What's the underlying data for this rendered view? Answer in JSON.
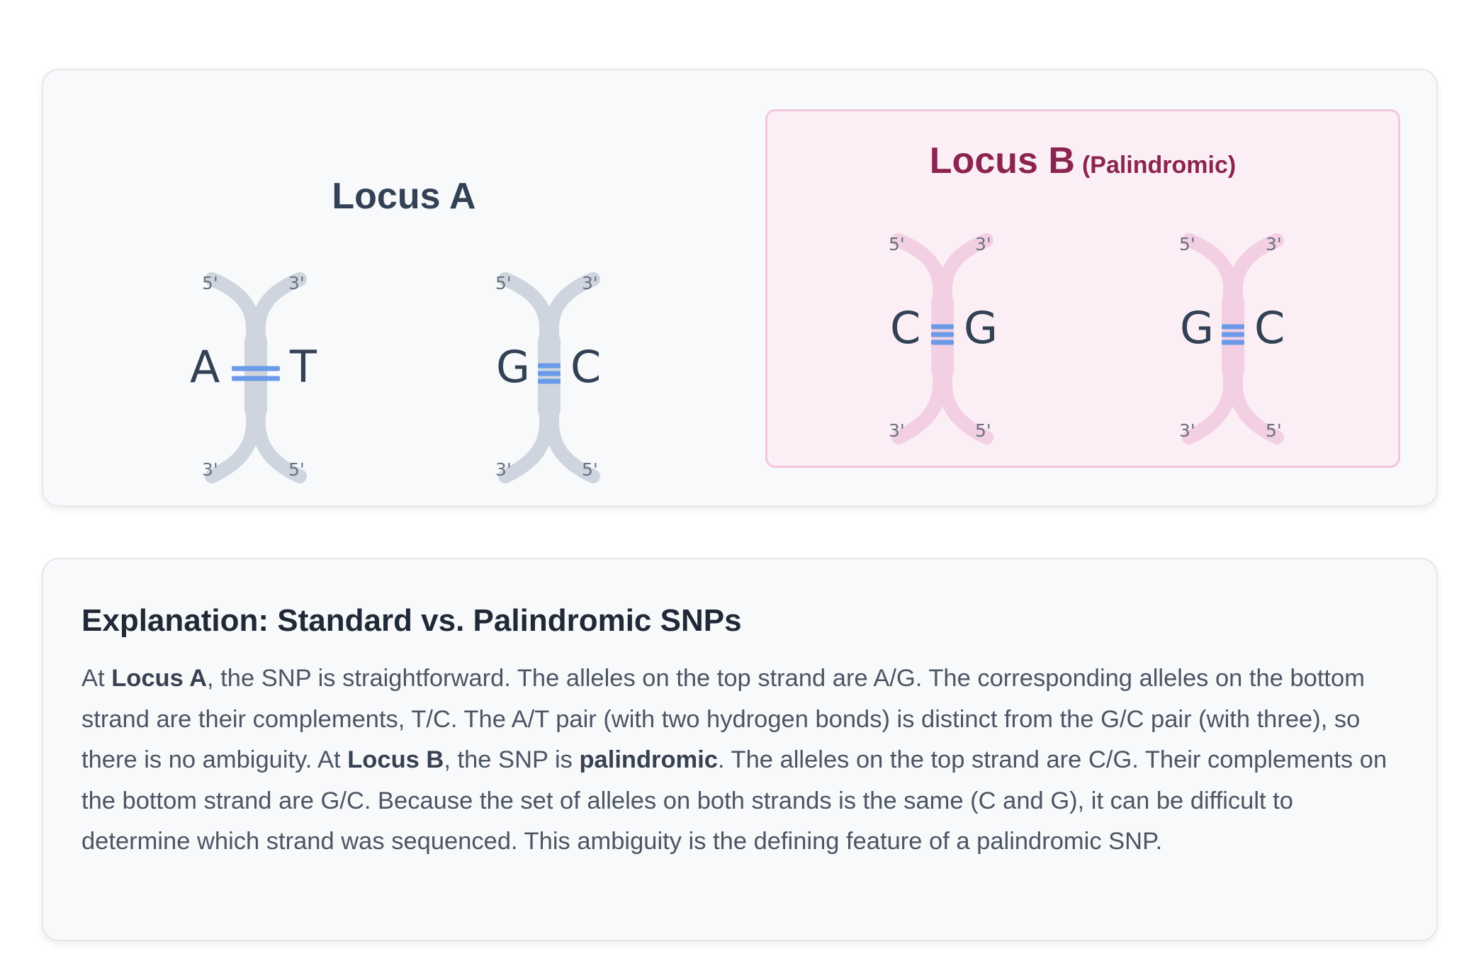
{
  "locus_a": {
    "title": "Locus A",
    "pairs": [
      {
        "left": "A",
        "right": "T",
        "bonds": 2
      },
      {
        "left": "G",
        "right": "C",
        "bonds": 3
      }
    ]
  },
  "locus_b": {
    "title": "Locus B",
    "subtitle": "(Palindromic)",
    "pairs": [
      {
        "left": "C",
        "right": "G",
        "bonds": 3
      },
      {
        "left": "G",
        "right": "C",
        "bonds": 3
      }
    ]
  },
  "strand_ends": {
    "top_left": "5'",
    "top_right": "3'",
    "bottom_left": "3'",
    "bottom_right": "5'"
  },
  "colors": {
    "strand_standard": "#cfd5df",
    "strand_palindromic": "#f3cfe3",
    "bond": "#6b9be8",
    "highlight_bg": "#fbeff5",
    "highlight_border": "#f2c6dc",
    "highlight_title": "#8b2450"
  },
  "explanation": {
    "title": "Explanation: Standard vs. Palindromic SNPs",
    "p1": "At ",
    "b1": "Locus A",
    "p2": ", the SNP is straightforward. The alleles on the top strand are A/G. The corresponding alleles on the bottom strand are their complements, T/C. The A/T pair (with two hydrogen bonds) is distinct from the G/C pair (with three), so there is no ambiguity. At ",
    "b2": "Locus B",
    "p3": ", the SNP is ",
    "b3": "palindromic",
    "p4": ". The alleles on the top strand are C/G. Their complements on the bottom strand are G/C. Because the set of alleles on both strands is the same (C and G), it can be difficult to determine which strand was sequenced. This ambiguity is the defining feature of a palindromic SNP."
  }
}
